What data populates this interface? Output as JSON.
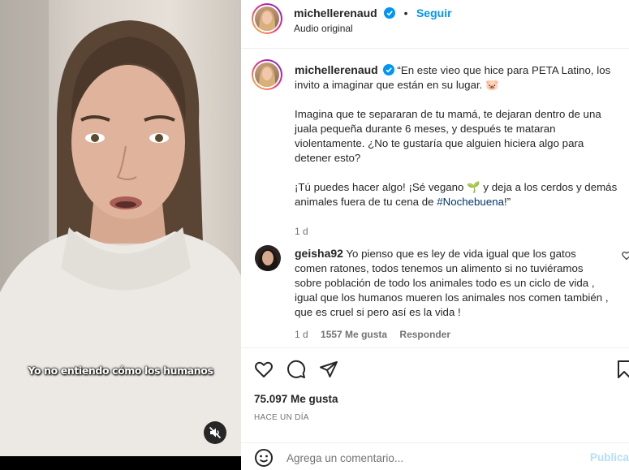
{
  "video": {
    "subtitle": "Yo no entiendo cómo los humanos",
    "mute_icon": "speaker-muted-icon"
  },
  "header": {
    "username": "michellerenaud",
    "separator": "•",
    "follow_label": "Seguir",
    "audio_label": "Audio original",
    "verified_icon": "verified-badge-icon"
  },
  "caption": {
    "username": "michellerenaud",
    "para1": "“En este vieo que hice para PETA Latino, los invito a imaginar que están en su lugar. 🐷",
    "para2": "Imagina que te separaran de tu mamá, te dejaran dentro de una juala pequeña durante 6 meses, y después te mataran violentamente. ¿No te gustaría que alguien hiciera algo para detener esto?",
    "para3_before": "¡Tú puedes hacer algo! ¡Sé vegano 🌱 y deja a los cerdos y demás animales fuera de tu cena de ",
    "hashtag": "#Nochebuena",
    "para3_after": "!”",
    "time": "1 d"
  },
  "comment": {
    "username": "geisha92",
    "text": "Yo pienso que es ley de vida igual que los gatos comen ratones, todos tenemos un alimento si no tuviéramos sobre población de todo los animales todo es un ciclo de vida , igual que los humanos mueren los animales nos comen también , que es cruel si pero así es la vida !",
    "time": "1 d",
    "likes": "1557 Me gusta",
    "reply_label": "Responder"
  },
  "actions": {
    "likes_count": "75.097 Me gusta",
    "timestamp": "HACE UN DÍA"
  },
  "comment_bar": {
    "placeholder": "Agrega un comentario...",
    "publish_label": "Publica"
  },
  "colors": {
    "accent": "#0095f6",
    "hashtag": "#00376b",
    "muted_text": "#737373",
    "publish_disabled": "#b2dffc"
  }
}
